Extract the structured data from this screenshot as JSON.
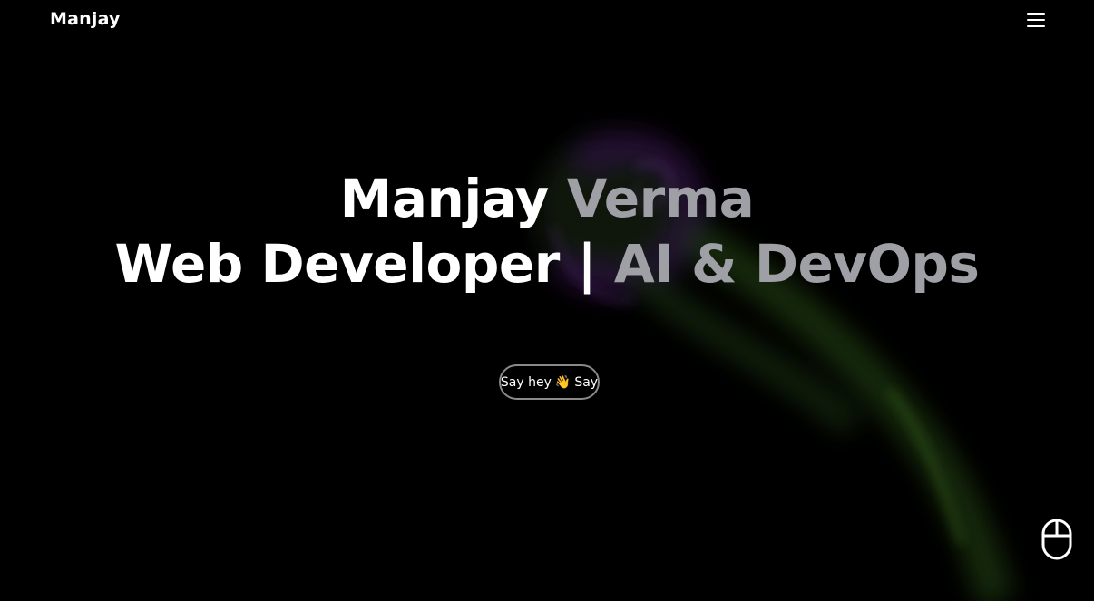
{
  "nav": {
    "brand": "Manjay",
    "menu_icon": "hamburger-menu-icon"
  },
  "hero": {
    "line1_first": "Manjay",
    "line1_second": "Verma",
    "line2_first": "Web Developer |",
    "line2_second": "AI & DevOps"
  },
  "cta": {
    "label_start": "Say hey",
    "wave_icon": "waving-hand-icon",
    "wave_glyph": "👋",
    "label_end": "Say"
  },
  "scroll_indicator": {
    "icon": "mouse-scroll-icon"
  },
  "colors": {
    "background": "#000000",
    "text_primary": "#ffffff",
    "text_secondary": "#9fa0a6",
    "button_border": "#8a8a8a",
    "smoke_purple": "#6a2a8c",
    "smoke_green": "#3f7a1e"
  }
}
